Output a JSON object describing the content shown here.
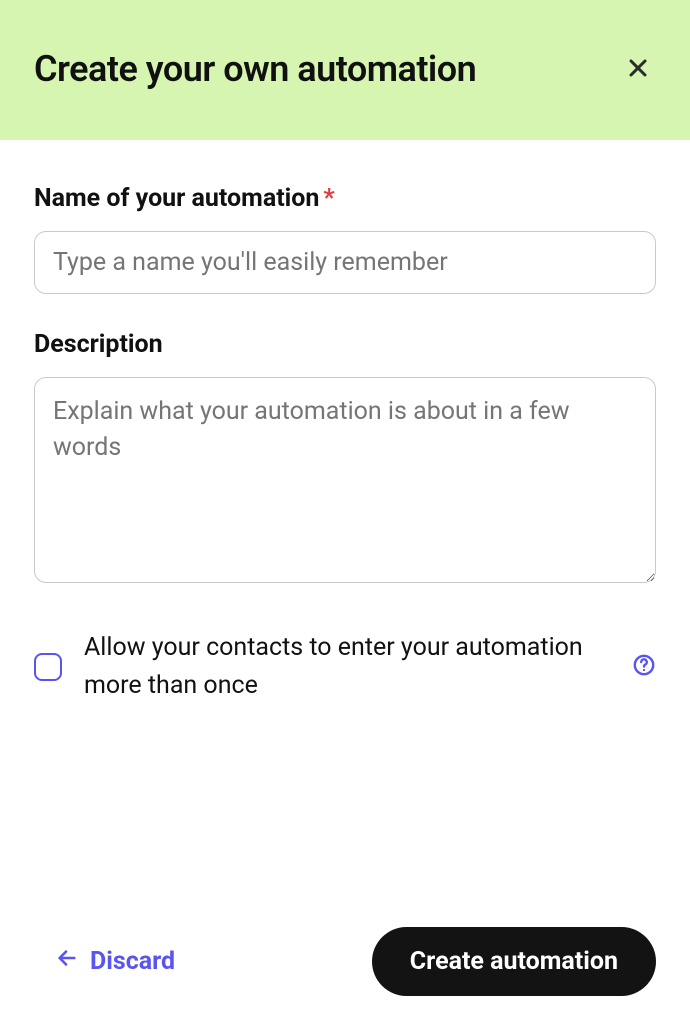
{
  "header": {
    "title": "Create your own automation"
  },
  "form": {
    "name": {
      "label": "Name of your automation",
      "required_mark": "*",
      "placeholder": "Type a name you'll easily remember",
      "value": ""
    },
    "description": {
      "label": "Description",
      "placeholder": "Explain what your automation is about in a few words",
      "value": ""
    },
    "reentry": {
      "label": "Allow your contacts to enter your automation more than once",
      "checked": false
    }
  },
  "footer": {
    "discard_label": "Discard",
    "submit_label": "Create automation"
  }
}
